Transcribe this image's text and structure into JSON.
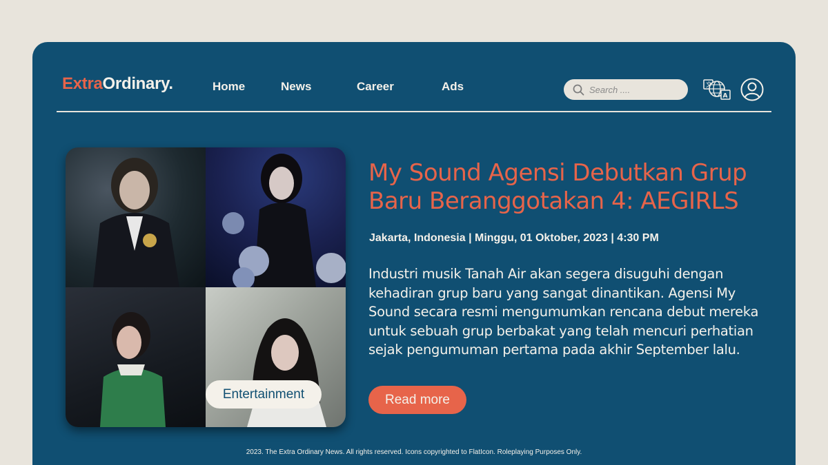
{
  "brand": {
    "part1": "Extra",
    "part2": "Ordinary."
  },
  "nav": {
    "home": "Home",
    "news": "News",
    "career": "Career",
    "ads": "Ads"
  },
  "search": {
    "placeholder": "Search ...."
  },
  "icons": {
    "search": "search-icon",
    "language": "language-icon",
    "user": "user-icon"
  },
  "article": {
    "category": "Entertainment",
    "headline": "My Sound Agensi Debutkan Grup Baru Beranggotakan 4: AEGIRLS",
    "meta": "Jakarta, Indonesia | Minggu, 01 Oktober, 2023 | 4:30 PM",
    "body": "Industri musik Tanah Air akan segera disuguhi dengan kehadiran grup baru yang sangat dinantikan. Agensi My Sound secara resmi mengumumkan rencana debut mereka untuk sebuah grup berbakat yang telah mencuri perhatian sejak pengumuman pertama pada akhir September lalu.",
    "read_more": "Read more"
  },
  "footer": "2023. The Extra Ordinary News. All rights reserved. Icons copyrighted  to FlatIcon. Roleplaying Purposes Only.",
  "colors": {
    "accent": "#e7644a",
    "card": "#104f72",
    "background": "#e8e4dc",
    "text": "#f4f1ea"
  }
}
